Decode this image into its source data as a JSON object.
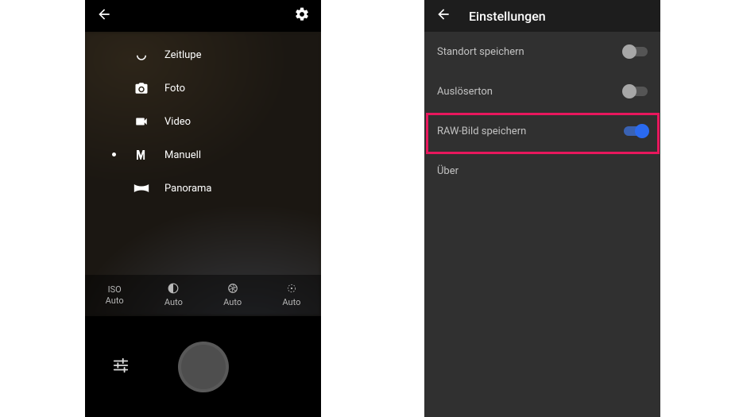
{
  "camera": {
    "modes": [
      {
        "key": "slowmo",
        "label": "Zeitlupe"
      },
      {
        "key": "photo",
        "label": "Foto"
      },
      {
        "key": "video",
        "label": "Video"
      },
      {
        "key": "manual",
        "label": "Manuell"
      },
      {
        "key": "panorama",
        "label": "Panorama"
      }
    ],
    "selected_mode_index": 3,
    "manual_params": {
      "iso": {
        "top": "ISO",
        "value": "Auto"
      },
      "exposure": {
        "top": "icon",
        "value": "Auto"
      },
      "aperture": {
        "top": "icon",
        "value": "Auto"
      },
      "focus": {
        "top": "icon",
        "value": "Auto"
      }
    }
  },
  "settings": {
    "title": "Einstellungen",
    "items": [
      {
        "key": "location",
        "label": "Standort speichern",
        "toggled": false
      },
      {
        "key": "shutter",
        "label": "Auslöserton",
        "toggled": false
      },
      {
        "key": "raw",
        "label": "RAW-Bild speichern",
        "toggled": true
      },
      {
        "key": "about",
        "label": "Über",
        "toggled": null
      }
    ],
    "highlight_index": 2
  }
}
